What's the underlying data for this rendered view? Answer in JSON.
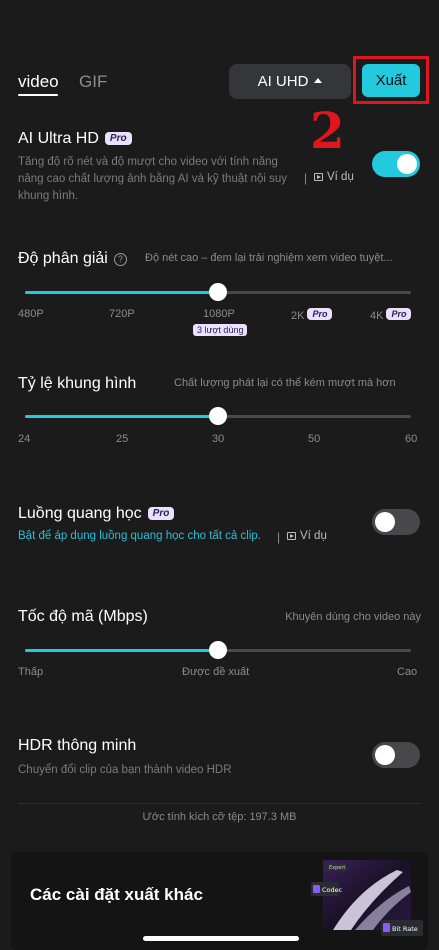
{
  "tabs": [
    {
      "label": "video"
    },
    {
      "label": "GIF"
    }
  ],
  "quality": {
    "label": "AI UHD"
  },
  "export": {
    "label": "Xuất"
  },
  "annotation": {
    "step": "2"
  },
  "ai_uhd": {
    "title": "AI Ultra HD",
    "badge": "Pro",
    "desc": "Tăng độ rõ nét và độ mượt cho video với tính năng nâng cao chất lượng ảnh bằng AI và kỹ thuật nội suy khung hình.",
    "example": "Ví dụ",
    "toggle_on": true
  },
  "resolution": {
    "title": "Độ phân giải",
    "hint": "Độ nét cao – đem lại trải nghiệm xem video tuyệt...",
    "ticks": [
      "480P",
      "720P",
      "1080P",
      "2K",
      "4K"
    ],
    "selected": "1080P",
    "selected_index": 2,
    "uses_badge": "3 lượt dùng",
    "pro_badge": "Pro"
  },
  "framerate": {
    "title": "Tỷ lệ khung hình",
    "hint": "Chất lượng phát lại có thể kém mượt mà hơn",
    "ticks": [
      "24",
      "25",
      "30",
      "50",
      "60"
    ],
    "selected": "30",
    "selected_index": 2
  },
  "optical_flow": {
    "title": "Luồng quang học",
    "badge": "Pro",
    "desc": "Bật để áp dụng luồng quang học cho tất cả clip.",
    "example": "Ví dụ",
    "toggle_on": false
  },
  "bitrate": {
    "title": "Tốc độ mã (Mbps)",
    "hint": "Khuyên dùng cho video này",
    "labels": [
      "Thấp",
      "Được đề xuất",
      "Cao"
    ],
    "selected_index": 1
  },
  "hdr": {
    "title": "HDR thông minh",
    "desc": "Chuyển đổi clip của bạn thành video HDR",
    "toggle_on": false
  },
  "file_size": "Ước tính kích cỡ tệp: 197.3 MB",
  "more_settings": {
    "title": "Các cài đặt xuất khác",
    "promo_labels": [
      "Expert",
      "Codec",
      "Bit Rate"
    ]
  },
  "colors": {
    "accent": "#23c9dc",
    "annotation": "#e0161e",
    "background": "#1b1b1c"
  }
}
